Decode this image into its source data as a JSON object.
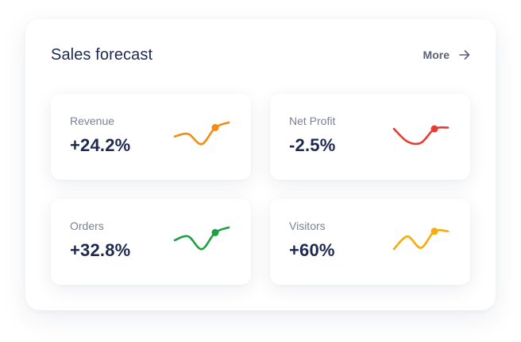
{
  "widget": {
    "title": "Sales forecast",
    "more_label": "More",
    "more_icon": "arrow-right-icon"
  },
  "colors": {
    "title": "#1d2951",
    "label": "#7b8194",
    "value": "#1d2951",
    "more": "#5b6175"
  },
  "stats": [
    {
      "key": "revenue",
      "label": "Revenue",
      "value": "+24.2%",
      "color": "#f38c12",
      "trend": [
        0.55,
        0.45,
        0.85,
        0.2,
        0.0
      ],
      "marker_index": 3
    },
    {
      "key": "net-profit",
      "label": "Net Profit",
      "value": "-2.5%",
      "color": "#ec3a2f",
      "trend": [
        0.25,
        0.75,
        0.8,
        0.25,
        0.2
      ],
      "marker_index": 3
    },
    {
      "key": "orders",
      "label": "Orders",
      "value": "+32.8%",
      "color": "#1ea043",
      "trend": [
        0.5,
        0.35,
        0.85,
        0.2,
        0.0
      ],
      "marker_index": 3
    },
    {
      "key": "visitors",
      "label": "Visitors",
      "value": "+60%",
      "color": "#f6ac0c",
      "trend": [
        0.85,
        0.35,
        0.8,
        0.15,
        0.15
      ],
      "marker_index": 3
    }
  ]
}
